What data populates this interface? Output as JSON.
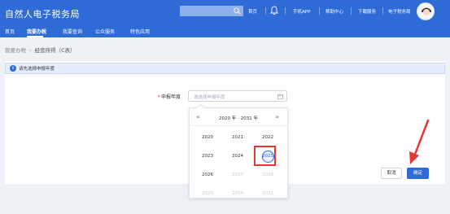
{
  "header": {
    "site_title": "自然人电子税务局",
    "search_placeholder": "",
    "links": {
      "home": "首页",
      "mobile_app": "手机APP",
      "help_center": "帮助中心",
      "download": "下载服务",
      "my_bureau": "电子税务局"
    }
  },
  "nav": {
    "items": [
      "首页",
      "我要办税",
      "我要查询",
      "公众服务",
      "特色应用"
    ],
    "active_index": 1
  },
  "breadcrumb": {
    "parent": "我要办税",
    "current": "经营所得（C表）"
  },
  "notice": {
    "icon": "info-icon",
    "text": "请先选择申报年度"
  },
  "form": {
    "year_label": "申报年度",
    "year_placeholder": "请选择申报年度"
  },
  "picker": {
    "prev_label": "«",
    "next_label": "»",
    "range_label": "2020 年 - 2031 年",
    "years": [
      {
        "label": "2020",
        "state": "normal"
      },
      {
        "label": "2021",
        "state": "normal"
      },
      {
        "label": "2022",
        "state": "normal"
      },
      {
        "label": "2023",
        "state": "normal"
      },
      {
        "label": "2024",
        "state": "normal"
      },
      {
        "label": "2025",
        "state": "selected"
      },
      {
        "label": "2026",
        "state": "normal"
      },
      {
        "label": "2027",
        "state": "disabled"
      },
      {
        "label": "2028",
        "state": "disabled"
      },
      {
        "label": "2029",
        "state": "disabled"
      },
      {
        "label": "2030",
        "state": "disabled"
      },
      {
        "label": "2031",
        "state": "disabled"
      }
    ]
  },
  "buttons": {
    "cancel": "取消",
    "confirm": "确定"
  },
  "colors": {
    "brand": "#2f6bd7",
    "highlight_box": "#e53935",
    "arrow": "#e53935"
  }
}
